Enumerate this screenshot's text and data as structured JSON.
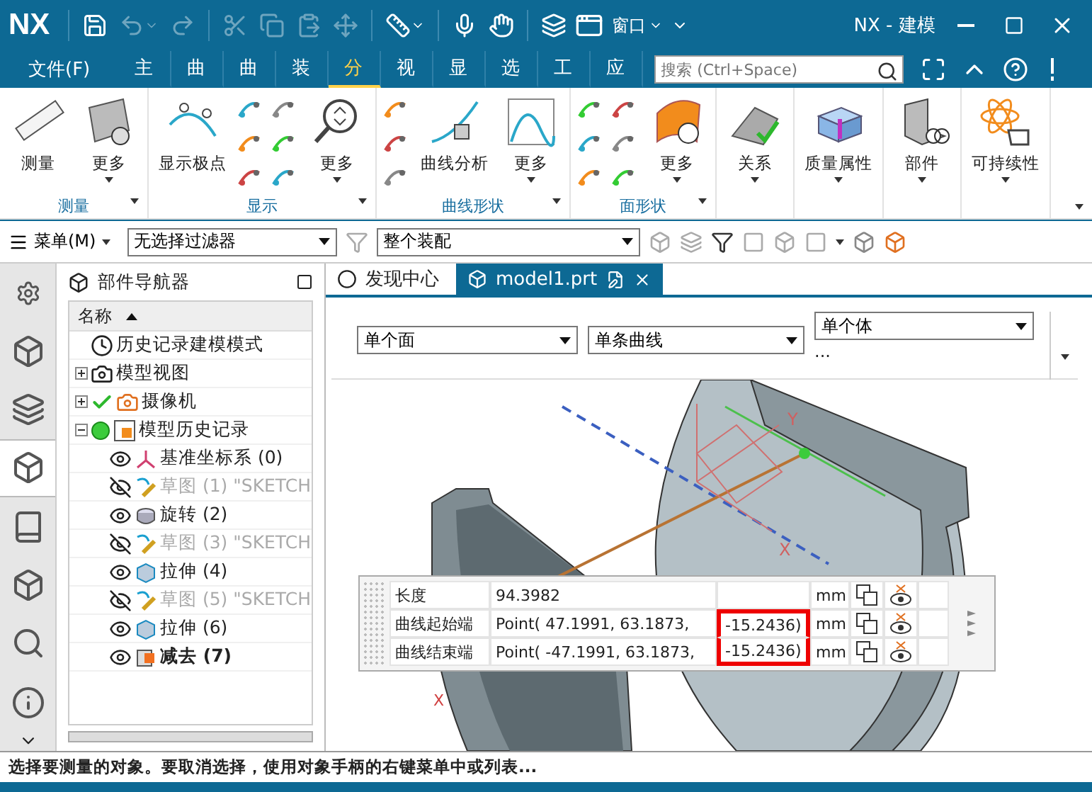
{
  "title_bar": {
    "logo": "NX",
    "quick_access": [
      {
        "disabled": false,
        "dropdown": false
      },
      {
        "disabled": true,
        "dropdown": true
      },
      {
        "disabled": true,
        "dropdown": false
      },
      {
        "disabled": true,
        "dropdown": false
      },
      {
        "disabled": true,
        "dropdown": false
      },
      {
        "disabled": true,
        "dropdown": false
      },
      {
        "disabled": true,
        "dropdown": false
      },
      {
        "disabled": false,
        "dropdown": true
      },
      {
        "disabled": false,
        "dropdown": false
      },
      {
        "disabled": false,
        "dropdown": false
      },
      {
        "disabled": false,
        "dropdown": false
      }
    ],
    "window_menu": "窗口",
    "title": "NX - 建模"
  },
  "menu_bar": {
    "file_menu": "文件(F)",
    "tabs": [
      {
        "label": "主",
        "selected": false
      },
      {
        "label": "曲",
        "selected": false
      },
      {
        "label": "曲",
        "selected": false
      },
      {
        "label": "装",
        "selected": false
      },
      {
        "label": "分",
        "selected": true
      },
      {
        "label": "视",
        "selected": false
      },
      {
        "label": "显",
        "selected": false
      },
      {
        "label": "选",
        "selected": false
      },
      {
        "label": "工",
        "selected": false
      },
      {
        "label": "应",
        "selected": false
      }
    ],
    "search": {
      "placeholder": "搜索 (Ctrl+Space)"
    }
  },
  "ribbon": {
    "groups": [
      {
        "label": "测量",
        "buttons": [
          {
            "kind": "large",
            "label": "测量",
            "dropdown": false
          },
          {
            "kind": "large",
            "label": "更多",
            "dropdown": true
          }
        ]
      },
      {
        "label": "显示",
        "buttons": [
          {
            "kind": "large",
            "label": "显示极点",
            "dropdown": false
          },
          {
            "kind": "small-stack"
          },
          {
            "kind": "small-stack"
          },
          {
            "kind": "large",
            "label": "更多",
            "dropdown": true
          }
        ]
      },
      {
        "label": "曲线形状",
        "buttons": [
          {
            "kind": "small-stack"
          },
          {
            "kind": "large",
            "label": "曲线分析",
            "dropdown": false
          },
          {
            "kind": "large",
            "label": "更多",
            "dropdown": true
          }
        ]
      },
      {
        "label": "面形状",
        "buttons": [
          {
            "kind": "small-stack"
          },
          {
            "kind": "small-stack"
          },
          {
            "kind": "large",
            "label": "更多",
            "dropdown": true
          }
        ]
      },
      {
        "buttons": [
          {
            "kind": "large",
            "label": "关系",
            "dropdown": true
          }
        ]
      },
      {
        "buttons": [
          {
            "kind": "large",
            "label": "质量属性",
            "dropdown": true
          }
        ]
      },
      {
        "buttons": [
          {
            "kind": "large",
            "label": "部件",
            "dropdown": true
          }
        ]
      },
      {
        "buttons": [
          {
            "kind": "large",
            "label": "可持续性",
            "dropdown": true
          }
        ]
      }
    ]
  },
  "toolbar": {
    "menu_button": "菜单(M)",
    "filters": [
      "无选择过滤器",
      "整个装配"
    ]
  },
  "resource_bar": [
    {
      "selected": false
    },
    {
      "selected": false
    },
    {
      "selected": false
    },
    {
      "selected": true
    },
    {
      "selected": false
    },
    {
      "selected": false
    },
    {
      "selected": false
    },
    {
      "selected": false
    }
  ],
  "part_navigator": {
    "title": "部件导航器",
    "column": "名称",
    "tree": [
      {
        "label": "历史记录建模模式",
        "kind": "history-mode",
        "checked": false,
        "active": false
      },
      {
        "label": "模型视图",
        "kind": "views",
        "checked": false,
        "active": false,
        "expanded": false
      },
      {
        "label": "摄像机",
        "kind": "cameras",
        "checked": true,
        "active": false,
        "expanded": false
      },
      {
        "label": "模型历史记录",
        "kind": "history",
        "checked": false,
        "active": true,
        "expanded": true,
        "children": [
          {
            "label": "基准坐标系 (0)",
            "kind": "datum",
            "visible": true,
            "current": false
          },
          {
            "label": "草图 (1) \"SKETCH",
            "kind": "sketch",
            "visible": false,
            "current": false
          },
          {
            "label": "旋转 (2)",
            "kind": "revolve",
            "visible": true,
            "current": false
          },
          {
            "label": "草图 (3) \"SKETCH",
            "kind": "sketch",
            "visible": false,
            "current": false
          },
          {
            "label": "拉伸 (4)",
            "kind": "extrude",
            "visible": true,
            "current": false
          },
          {
            "label": "草图 (5) \"SKETCH",
            "kind": "sketch",
            "visible": false,
            "current": false
          },
          {
            "label": "拉伸 (6)",
            "kind": "extrude",
            "visible": true,
            "current": false
          },
          {
            "label": "减去 (7)",
            "kind": "subtract",
            "visible": true,
            "current": true
          }
        ]
      }
    ]
  },
  "document_tabs": [
    {
      "label": "发现中心",
      "selected": false
    },
    {
      "label": "model1.prt",
      "selected": true
    }
  ],
  "selection_bar": {
    "dropdowns": [
      "单个面",
      "单条曲线",
      "单个体"
    ],
    "more": "..."
  },
  "viewport": {
    "axis_labels": [
      "Y",
      "X",
      "X"
    ]
  },
  "measure_table": {
    "rows": [
      {
        "label": "长度",
        "value": "94.3982",
        "unit": "mm",
        "highlighted": false
      },
      {
        "label": "曲线起始端",
        "value": "Point( 47.1991, 63.1873,",
        "value_end": "-15.2436)",
        "unit": "mm",
        "highlighted": true
      },
      {
        "label": "曲线结束端",
        "value": "Point( -47.1991, 63.1873,",
        "value_end": "-15.2436)",
        "unit": "mm",
        "highlighted": true
      }
    ]
  },
  "status_bar": {
    "message": "选择要测量的对象。要取消选择，使用对象手柄的右键菜单中或列表..."
  }
}
